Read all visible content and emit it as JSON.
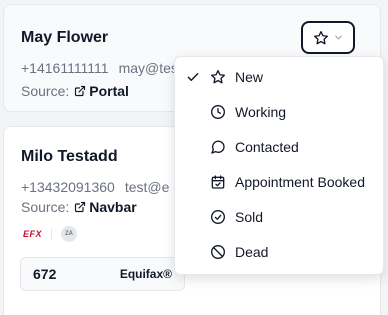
{
  "leads": [
    {
      "name": "May Flower",
      "phone": "+14161111111",
      "email": "may@tes",
      "source_label": "Source:",
      "source_value": "Portal"
    },
    {
      "name": "Milo Testadd",
      "phone": "+13432091360",
      "email": "test@e",
      "source_label": "Source:",
      "source_value": "Navbar",
      "bureau_logo_text": "EFX",
      "avatar_initials": "ZA",
      "credit_score": "672",
      "credit_bureau": "Equifax®"
    }
  ],
  "status_button": {
    "icon": "star-icon",
    "caret": "chevron-down-icon"
  },
  "status_menu": {
    "items": [
      {
        "label": "New",
        "icon": "star-icon",
        "checked": true
      },
      {
        "label": "Working",
        "icon": "clock-icon",
        "checked": false
      },
      {
        "label": "Contacted",
        "icon": "message-circle-icon",
        "checked": false
      },
      {
        "label": "Appointment Booked",
        "icon": "calendar-check-icon",
        "checked": false
      },
      {
        "label": "Sold",
        "icon": "check-circle-icon",
        "checked": false
      },
      {
        "label": "Dead",
        "icon": "ban-icon",
        "checked": false
      }
    ]
  },
  "colors": {
    "efx_red": "#c8102e",
    "text": "#111827",
    "muted": "#6b7280",
    "border": "#e5e7eb"
  }
}
